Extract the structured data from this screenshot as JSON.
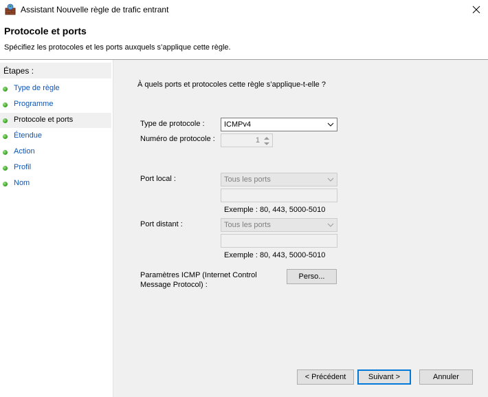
{
  "window": {
    "title": "Assistant Nouvelle règle de trafic entrant"
  },
  "header": {
    "title": "Protocole et ports",
    "subtitle": "Spécifiez les protocoles et les ports auxquels s’applique cette règle."
  },
  "steps": {
    "heading": "Étapes :",
    "items": [
      {
        "label": "Type de règle"
      },
      {
        "label": "Programme"
      },
      {
        "label": "Protocole et ports"
      },
      {
        "label": "Étendue"
      },
      {
        "label": "Action"
      },
      {
        "label": "Profil"
      },
      {
        "label": "Nom"
      }
    ]
  },
  "main": {
    "question": "À quels ports et protocoles cette règle s’applique-t-elle ?",
    "protocol_type_label": "Type de protocole :",
    "protocol_type_value": "ICMPv4",
    "protocol_number_label": "Numéro de protocole :",
    "protocol_number_value": "1",
    "local_port_label": "Port local :",
    "local_port_value": "Tous les ports",
    "local_port_example": "Exemple : 80, 443, 5000-5010",
    "remote_port_label": "Port distant :",
    "remote_port_value": "Tous les ports",
    "remote_port_example": "Exemple : 80, 443, 5000-5010",
    "icmp_label": "Paramètres ICMP (Internet Control",
    "icmp_label_line2": "Message Protocol) :",
    "icmp_button": "Perso..."
  },
  "footer": {
    "previous": "< Précédent",
    "next": "Suivant >",
    "cancel": "Annuler"
  },
  "icons": {
    "app": "firewall-rule-icon",
    "close": "close-icon",
    "dropdown": "chevron-down-icon",
    "step_status": "green-dot-icon"
  },
  "colors": {
    "accent": "#0078d7",
    "link": "#0b55b8",
    "content_bg": "#f0f0f0"
  }
}
